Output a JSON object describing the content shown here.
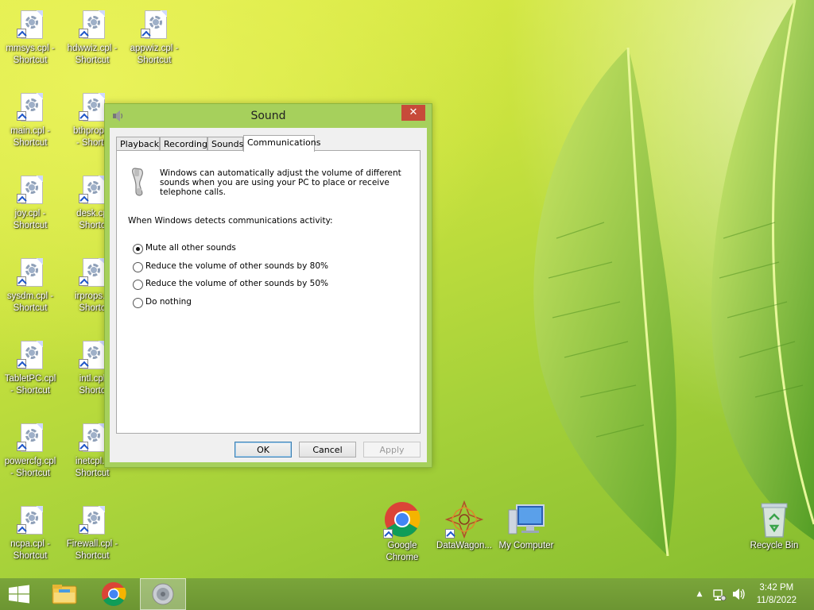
{
  "desktop": {
    "icons_left": [
      {
        "label": "mmsys.cpl -\nShortcut"
      },
      {
        "label": "hdwwiz.cpl -\nShortcut"
      },
      {
        "label": "appwiz.cpl -\nShortcut"
      },
      {
        "label": "main.cpl -\nShortcut"
      },
      {
        "label": "bthprops.\n- Shortc"
      },
      {
        "label": "joy.cpl -\nShortcut"
      },
      {
        "label": "desk.cp\nShortc"
      },
      {
        "label": "sysdm.cpl -\nShortcut"
      },
      {
        "label": "irprops.c\nShortc"
      },
      {
        "label": "TabletPC.cpl\n- Shortcut"
      },
      {
        "label": "intl.cpl\nShortc"
      },
      {
        "label": "powercfg.cpl\n- Shortcut"
      },
      {
        "label": "inetcpl.c\nShortcut"
      },
      {
        "label": "ncpa.cpl -\nShortcut"
      },
      {
        "label": "Firewall.cpl -\nShortcut"
      }
    ],
    "icons_bottom": [
      {
        "label": "Google\nChrome",
        "icon": "chrome-icon"
      },
      {
        "label": "DataWagon...",
        "icon": "datawagon-icon"
      },
      {
        "label": "My Computer",
        "icon": "computer-icon"
      },
      {
        "label": "Recycle Bin",
        "icon": "recycle-bin-icon"
      }
    ]
  },
  "dialog": {
    "title": "Sound",
    "close_label": "✕",
    "tabs": [
      "Playback",
      "Recording",
      "Sounds",
      "Communications"
    ],
    "active_tab": "Communications",
    "description": "Windows can automatically adjust the volume of different sounds when you are using your PC to place or receive telephone calls.",
    "group_label": "When Windows detects communications activity:",
    "options": [
      {
        "label": "Mute all other sounds",
        "checked": true
      },
      {
        "label": "Reduce the volume of other sounds by 80%",
        "checked": false
      },
      {
        "label": "Reduce the volume of other sounds by 50%",
        "checked": false
      },
      {
        "label": "Do nothing",
        "checked": false
      }
    ],
    "buttons": {
      "ok": "OK",
      "cancel": "Cancel",
      "apply": "Apply"
    }
  },
  "taskbar": {
    "pinned": [
      "start-icon",
      "file-explorer-icon",
      "chrome-icon",
      "sound-icon"
    ],
    "tray": {
      "time": "3:42 PM",
      "date": "11/8/2022",
      "overflow": "▲"
    }
  },
  "colors": {
    "accent": "#a6d05c",
    "close": "#c74a3a",
    "taskbar": "#709b35"
  }
}
